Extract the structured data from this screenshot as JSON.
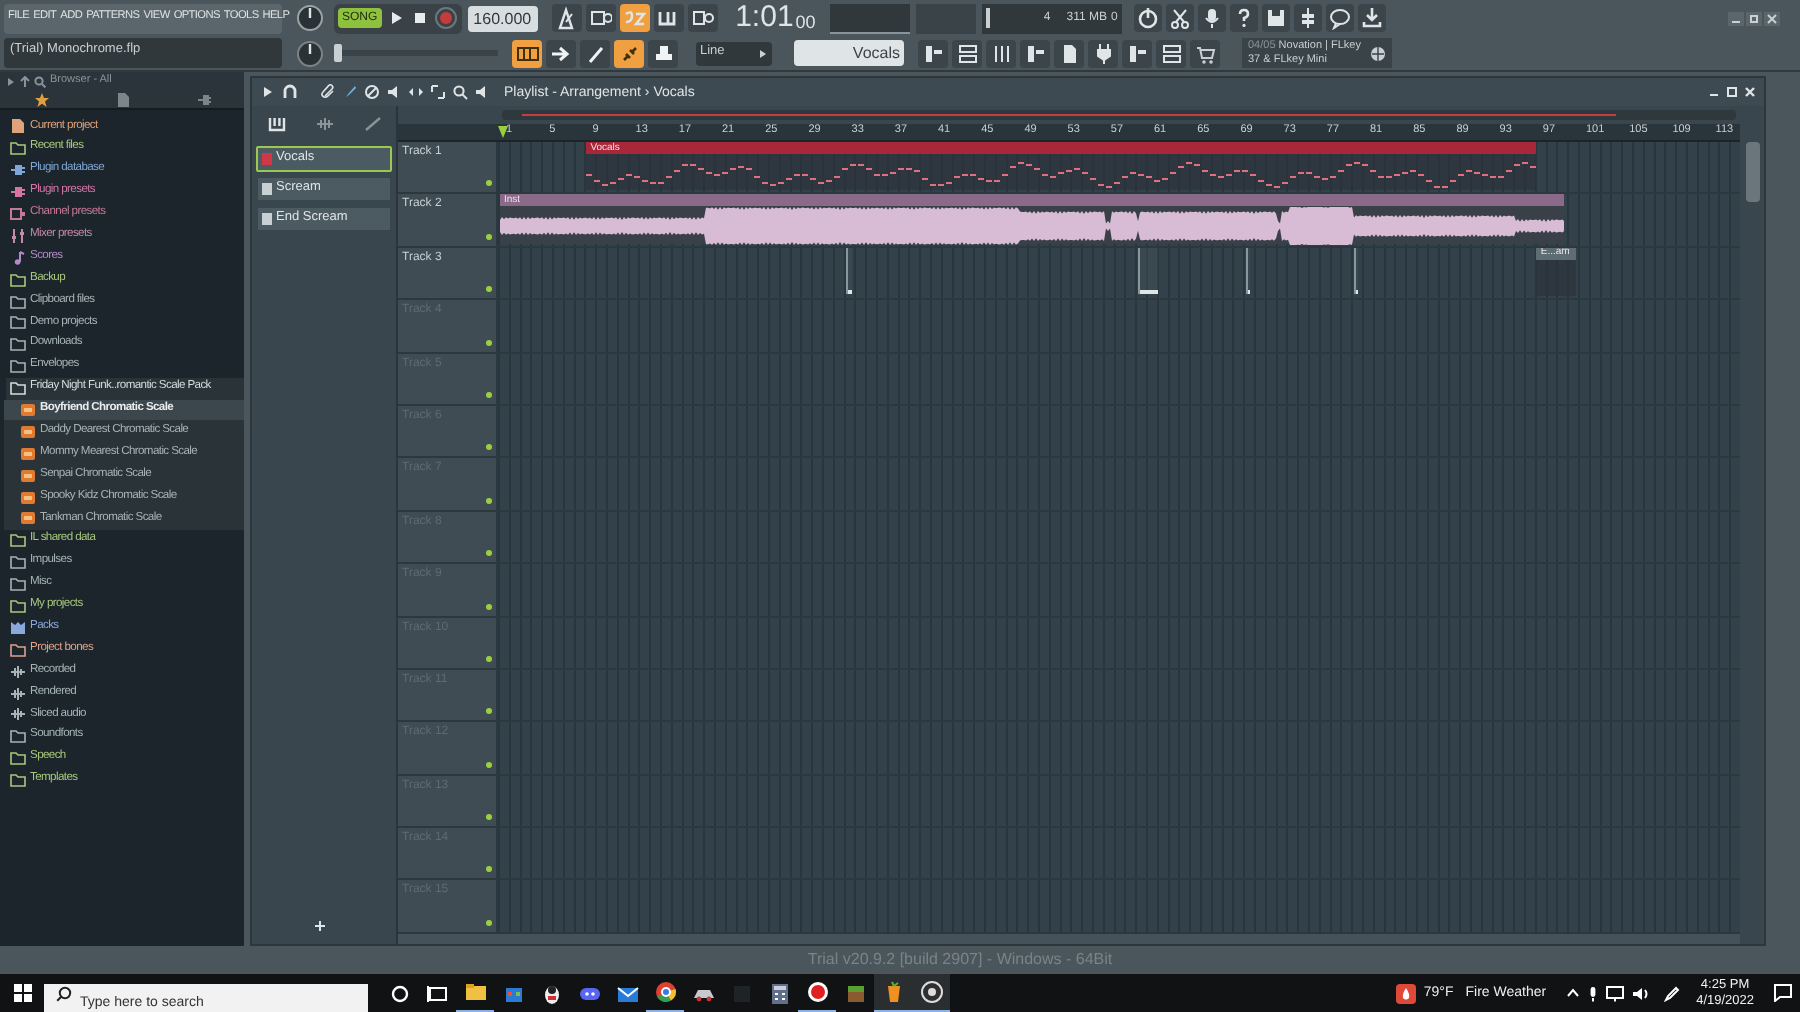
{
  "menu": [
    "FILE",
    "EDIT",
    "ADD",
    "PATTERNS",
    "VIEW",
    "OPTIONS",
    "TOOLS",
    "HELP"
  ],
  "transport": {
    "mode": "SONG",
    "song_mode": true,
    "recording": false,
    "tempo": "160.000"
  },
  "toolbar_toggles": [
    {
      "on": false
    },
    {
      "on": false
    },
    {
      "on": true
    },
    {
      "on": false
    },
    {
      "on": false
    }
  ],
  "time": {
    "main": "1:01",
    "sub": "00"
  },
  "monitor": {
    "polyphony": "4",
    "ram": "311 MB",
    "cpu": "0"
  },
  "project_title": "(Trial) Monochrome.flp",
  "tool_toggles": [
    {
      "on": true
    },
    {
      "on": false
    },
    {
      "on": false
    },
    {
      "on": true
    },
    {
      "on": false
    }
  ],
  "pitch_slider": {
    "level": 0
  },
  "snap": "Line",
  "pattern_selector": "Vocals",
  "hint": {
    "counter": "04/05",
    "text": "Novation | FLkey 37 & FLkey Mini"
  },
  "browser": {
    "title": "Browser - All",
    "items": [
      {
        "label": "Current project",
        "kind": "project",
        "color": "#e0a27a",
        "selected": false
      },
      {
        "label": "Recent files",
        "kind": "folder",
        "color": "#a8c87c",
        "selected": false
      },
      {
        "label": "Plugin database",
        "kind": "plugin",
        "color": "#7fa6d6",
        "selected": false
      },
      {
        "label": "Plugin presets",
        "kind": "plugin",
        "color": "#d674a6",
        "selected": false
      },
      {
        "label": "Channel presets",
        "kind": "preset",
        "color": "#c67898",
        "selected": false
      },
      {
        "label": "Mixer presets",
        "kind": "mixer",
        "color": "#c488a8",
        "selected": false
      },
      {
        "label": "Scores",
        "kind": "score",
        "color": "#b48ac8",
        "selected": false
      },
      {
        "label": "Backup",
        "kind": "folder",
        "color": "#a8c87c",
        "selected": false
      },
      {
        "label": "Clipboard files",
        "kind": "folder",
        "color": "#a6b4b6",
        "selected": false
      },
      {
        "label": "Demo projects",
        "kind": "folder",
        "color": "#a6b4b6",
        "selected": false
      },
      {
        "label": "Downloads",
        "kind": "folder",
        "color": "#a6b4b6",
        "selected": false
      },
      {
        "label": "Envelopes",
        "kind": "folder",
        "color": "#a6b4b6",
        "selected": false
      },
      {
        "label": "Friday Night Funk..romantic Scale Pack",
        "kind": "folder",
        "color": "#d4dcdc",
        "selected": false,
        "expanded": true,
        "children": [
          {
            "label": "Boyfriend Chromatic Scale",
            "kind": "file",
            "color": "#e8ecec",
            "selected": true
          },
          {
            "label": "Daddy Dearest Chromatic Scale",
            "kind": "file",
            "color": "#a6b4b6",
            "selected": false
          },
          {
            "label": "Mommy Mearest Chromatic Scale",
            "kind": "file",
            "color": "#a6b4b6",
            "selected": false
          },
          {
            "label": "Senpai Chromatic Scale",
            "kind": "file",
            "color": "#a6b4b6",
            "selected": false
          },
          {
            "label": "Spooky Kidz Chromatic Scale",
            "kind": "file",
            "color": "#a6b4b6",
            "selected": false
          },
          {
            "label": "Tankman Chromatic Scale",
            "kind": "file",
            "color": "#a6b4b6",
            "selected": false
          }
        ]
      },
      {
        "label": "IL shared data",
        "kind": "folder",
        "color": "#a8c87c",
        "selected": false
      },
      {
        "label": "Impulses",
        "kind": "folder",
        "color": "#a6b4b6",
        "selected": false
      },
      {
        "label": "Misc",
        "kind": "folder",
        "color": "#a6b4b6",
        "selected": false
      },
      {
        "label": "My projects",
        "kind": "folder",
        "color": "#a8c87c",
        "selected": false
      },
      {
        "label": "Packs",
        "kind": "pack",
        "color": "#8aa8dc",
        "selected": false
      },
      {
        "label": "Project bones",
        "kind": "folder",
        "color": "#e0a08a",
        "selected": false
      },
      {
        "label": "Recorded",
        "kind": "audio",
        "color": "#a6b4b6",
        "selected": false
      },
      {
        "label": "Rendered",
        "kind": "audio",
        "color": "#a6b4b6",
        "selected": false
      },
      {
        "label": "Sliced audio",
        "kind": "audio",
        "color": "#a6b4b6",
        "selected": false
      },
      {
        "label": "Soundfonts",
        "kind": "folder",
        "color": "#a6b4b6",
        "selected": false
      },
      {
        "label": "Speech",
        "kind": "folder",
        "color": "#a8c87c",
        "selected": false
      },
      {
        "label": "Templates",
        "kind": "folder",
        "color": "#a8c87c",
        "selected": false
      }
    ]
  },
  "playlist": {
    "title": "Playlist - Arrangement › Vocals",
    "patterns": [
      {
        "name": "Vocals",
        "color": "#d03848",
        "selected": true
      },
      {
        "name": "Scream",
        "color": "#c8d0d4",
        "selected": false
      },
      {
        "name": "End Scream",
        "color": "#c8d0d4",
        "selected": false
      }
    ],
    "ruler": [
      "1",
      "5",
      "9",
      "13",
      "17",
      "21",
      "25",
      "29",
      "33",
      "37",
      "41",
      "45",
      "49",
      "53",
      "57",
      "61",
      "65",
      "69",
      "73",
      "77",
      "81",
      "85",
      "89",
      "93",
      "97",
      "101",
      "105",
      "109",
      "113"
    ],
    "tracks": [
      {
        "name": "Track 1",
        "empty": false,
        "clips": [
          {
            "kind": "pattern",
            "name": "Vocals",
            "color": "#a8283a"
          }
        ]
      },
      {
        "name": "Track 2",
        "empty": false,
        "clips": [
          {
            "kind": "audio",
            "name": "Inst",
            "color": "#8a6a88"
          }
        ]
      },
      {
        "name": "Track 3",
        "empty": false,
        "clips": [
          {
            "kind": "stub"
          },
          {
            "kind": "stub"
          },
          {
            "kind": "stub"
          },
          {
            "kind": "stub"
          },
          {
            "kind": "pattern",
            "name": "E...am",
            "color": "#5e6c74"
          }
        ]
      },
      {
        "name": "Track 4",
        "empty": true
      },
      {
        "name": "Track 5",
        "empty": true
      },
      {
        "name": "Track 6",
        "empty": true
      },
      {
        "name": "Track 7",
        "empty": true
      },
      {
        "name": "Track 8",
        "empty": true
      },
      {
        "name": "Track 9",
        "empty": true
      },
      {
        "name": "Track 10",
        "empty": true
      },
      {
        "name": "Track 11",
        "empty": true
      },
      {
        "name": "Track 12",
        "empty": true
      },
      {
        "name": "Track 13",
        "empty": true
      },
      {
        "name": "Track 14",
        "empty": true
      },
      {
        "name": "Track 15",
        "empty": true
      }
    ]
  },
  "status": "Trial v20.9.2 [build 2907] - Windows - 64Bit",
  "taskbar": {
    "search_placeholder": "Type here to search",
    "temperature": "79°F",
    "weather": "Fire Weather",
    "time": "4:25 PM",
    "date": "4/19/2022"
  }
}
